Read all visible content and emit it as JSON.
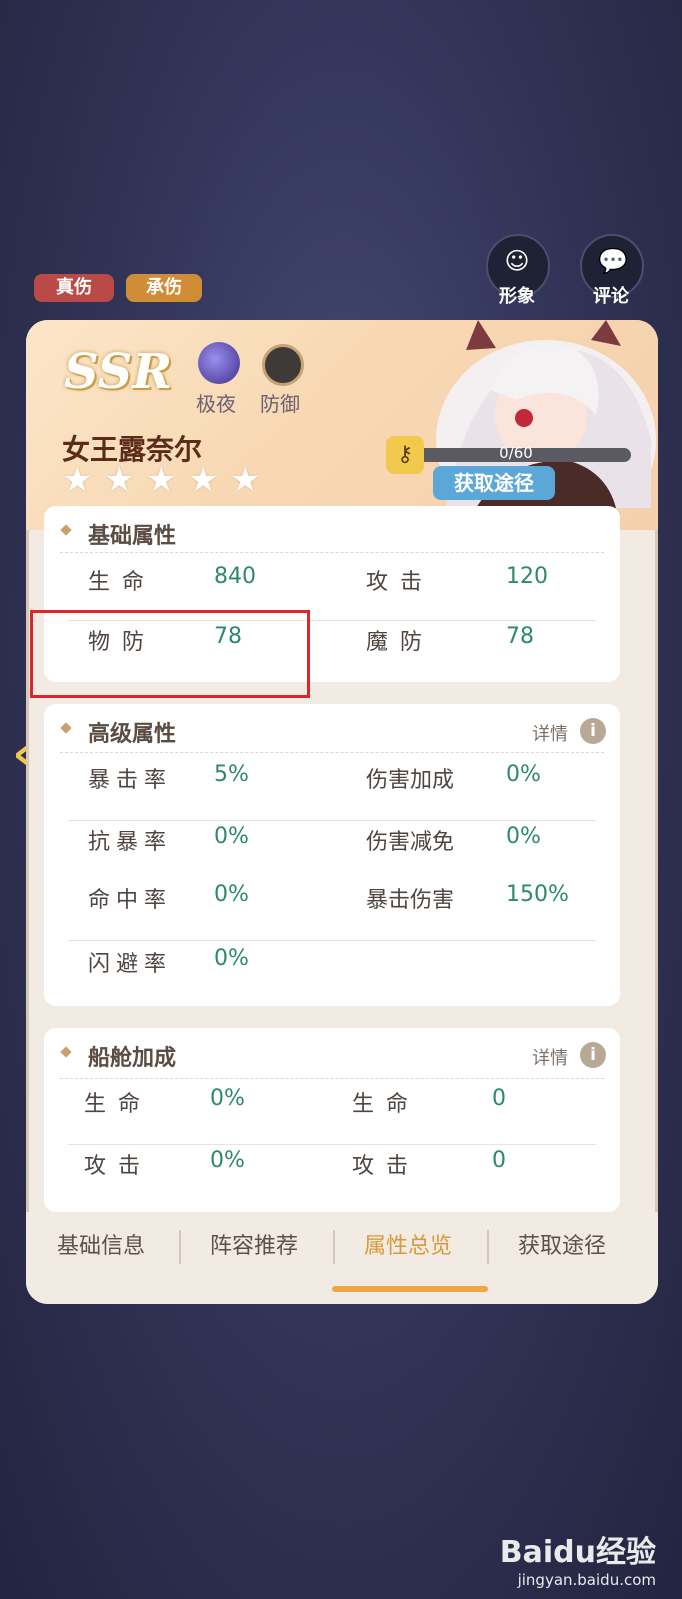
{
  "tags": [
    "真伤",
    "承伤"
  ],
  "top_buttons": {
    "appearance": "形象",
    "comment": "评论"
  },
  "hero": {
    "rarity": "SSR",
    "faction": "极夜",
    "role": "防御",
    "name": "女王露奈尔",
    "star_count": 5,
    "progress_text": "0/60",
    "progress_fraction": 0.0,
    "obtain_label": "获取途径"
  },
  "basic": {
    "title": "基础属性",
    "rows": [
      {
        "k1": "生命",
        "v1": "840",
        "k2": "攻击",
        "v2": "120"
      },
      {
        "k1": "物防",
        "v1": "78",
        "k2": "魔防",
        "v2": "78"
      }
    ]
  },
  "advanced": {
    "title": "高级属性",
    "detail": "详情",
    "rows": [
      {
        "k1": "暴击率",
        "v1": "5%",
        "k2": "伤害加成",
        "v2": "0%"
      },
      {
        "k1": "抗暴率",
        "v1": "0%",
        "k2": "伤害减免",
        "v2": "0%"
      },
      {
        "k1": "命中率",
        "v1": "0%",
        "k2": "暴击伤害",
        "v2": "150%"
      },
      {
        "k1": "闪避率",
        "v1": "0%",
        "k2": "",
        "v2": ""
      }
    ]
  },
  "cabin": {
    "title": "船舱加成",
    "detail": "详情",
    "rows": [
      {
        "k1": "生命",
        "v1": "0%",
        "k2": "生命",
        "v2": "0"
      },
      {
        "k1": "攻击",
        "v1": "0%",
        "k2": "攻击",
        "v2": "0"
      }
    ]
  },
  "tabs": [
    "基础信息",
    "阵容推荐",
    "属性总览",
    "获取途径"
  ],
  "active_tab_index": 2,
  "watermark": {
    "logo": "Baidu经验",
    "url": "jingyan.baidu.com"
  },
  "colors": {
    "value_green": "#2d8a68",
    "accent_orange": "#f0a742",
    "highlight_red": "#d9282a"
  }
}
